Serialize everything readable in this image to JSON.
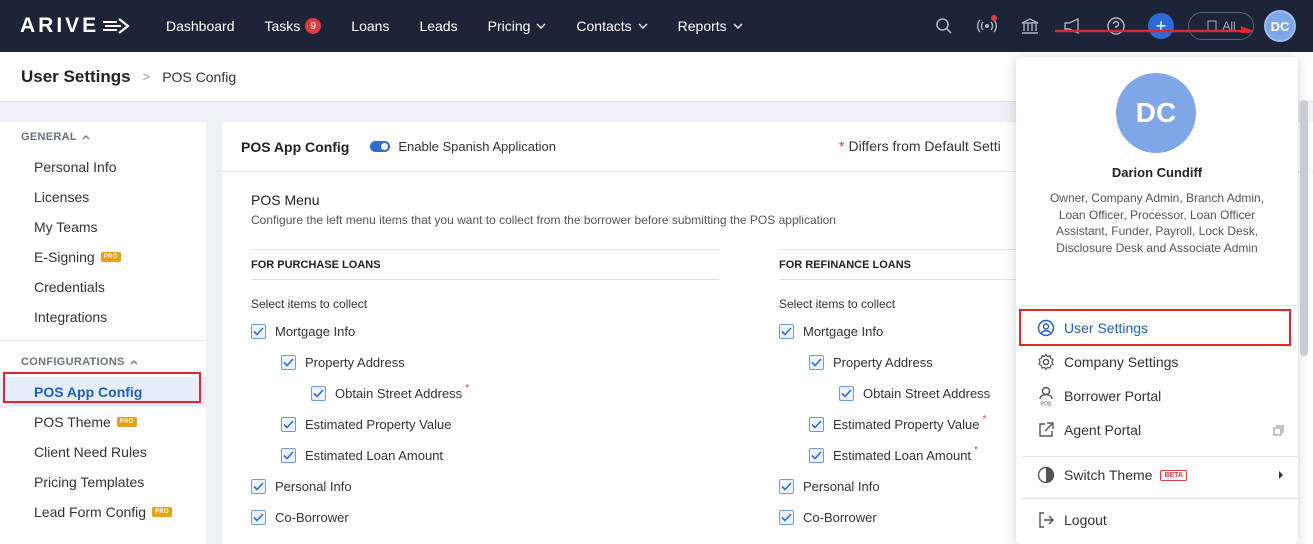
{
  "brand": {
    "logo_text": "ARIVE"
  },
  "nav": {
    "items": [
      {
        "label": "Dashboard",
        "has_chevron": false
      },
      {
        "label": "Tasks",
        "badge": "9"
      },
      {
        "label": "Loans"
      },
      {
        "label": "Leads"
      },
      {
        "label": "Pricing",
        "has_chevron": true
      },
      {
        "label": "Contacts",
        "has_chevron": true
      },
      {
        "label": "Reports",
        "has_chevron": true
      }
    ],
    "right": {
      "plus_label": "+",
      "all_label": "All",
      "avatar_initials": "DC",
      "icons": [
        "search-icon",
        "broadcast-icon",
        "bank-icon",
        "megaphone-icon",
        "help-icon"
      ]
    }
  },
  "header": {
    "title": "User Settings",
    "separator": ">",
    "breadcrumb": "POS Config"
  },
  "sidebar": {
    "general_label": "GENERAL",
    "general_items": [
      {
        "label": "Personal Info"
      },
      {
        "label": "Licenses"
      },
      {
        "label": "My Teams"
      },
      {
        "label": "E-Signing",
        "pro": "PRO"
      },
      {
        "label": "Credentials"
      },
      {
        "label": "Integrations"
      }
    ],
    "config_label": "CONFIGURATIONS",
    "config_items": [
      {
        "label": "POS App Config",
        "active": true
      },
      {
        "label": "POS Theme",
        "pro": "PRO"
      },
      {
        "label": "Client Need Rules"
      },
      {
        "label": "Pricing Templates"
      },
      {
        "label": "Lead Form Config",
        "pro": "PRO"
      }
    ]
  },
  "main": {
    "card_title": "POS App Config",
    "toggle_label": "Enable Spanish Application",
    "toggle_on": true,
    "differs_marker": "*",
    "differs_text": "Differs from Default Setti",
    "menu_title": "POS Menu",
    "menu_desc": "Configure the left menu items that you want to collect from the borrower before submitting the POS application",
    "purchase": {
      "heading": "FOR PURCHASE LOANS",
      "sub": "Select items to collect",
      "items": [
        {
          "label": "Mortgage Info",
          "level": 0,
          "required": false
        },
        {
          "label": "Property Address",
          "level": 1,
          "required": false
        },
        {
          "label": "Obtain Street Address",
          "level": 2,
          "required": true
        },
        {
          "label": "Estimated Property Value",
          "level": 1,
          "required": false
        },
        {
          "label": "Estimated Loan Amount",
          "level": 1,
          "required": false
        },
        {
          "label": "Personal Info",
          "level": 0,
          "required": false
        },
        {
          "label": "Co-Borrower",
          "level": 0,
          "required": false
        }
      ]
    },
    "refinance": {
      "heading": "FOR REFINANCE LOANS",
      "sub": "Select items to collect",
      "items": [
        {
          "label": "Mortgage Info",
          "level": 0,
          "required": false
        },
        {
          "label": "Property Address",
          "level": 1,
          "required": false
        },
        {
          "label": "Obtain Street Address",
          "level": 2,
          "required": false
        },
        {
          "label": "Estimated Property Value",
          "level": 1,
          "required": true
        },
        {
          "label": "Estimated Loan Amount",
          "level": 1,
          "required": true
        },
        {
          "label": "Personal Info",
          "level": 0,
          "required": false
        },
        {
          "label": "Co-Borrower",
          "level": 0,
          "required": false
        }
      ]
    },
    "required_marker": "*"
  },
  "user_menu": {
    "initials": "DC",
    "name": "Darion Cundiff",
    "roles": "Owner, Company Admin, Branch Admin, Loan Officer, Processor, Loan Officer Assistant, Funder, Payroll, Lock Desk, Disclosure Desk and Associate Admin",
    "items": [
      {
        "label": "User Settings",
        "icon": "user-gear-icon",
        "active": true
      },
      {
        "label": "Company Settings",
        "icon": "gear-icon"
      },
      {
        "label": "Borrower Portal",
        "icon": "pos-user-icon"
      },
      {
        "label": "Agent Portal",
        "icon": "external-link-icon"
      }
    ],
    "switch_theme": {
      "label": "Switch Theme",
      "badge": "BETA"
    },
    "logout": {
      "label": "Logout"
    }
  },
  "colors": {
    "nav_bg": "#1d2437",
    "accent": "#2f6bd4",
    "active_text": "#1e5fbf",
    "annotation_red": "#e0262b",
    "pro_badge": "#e3a21a"
  }
}
